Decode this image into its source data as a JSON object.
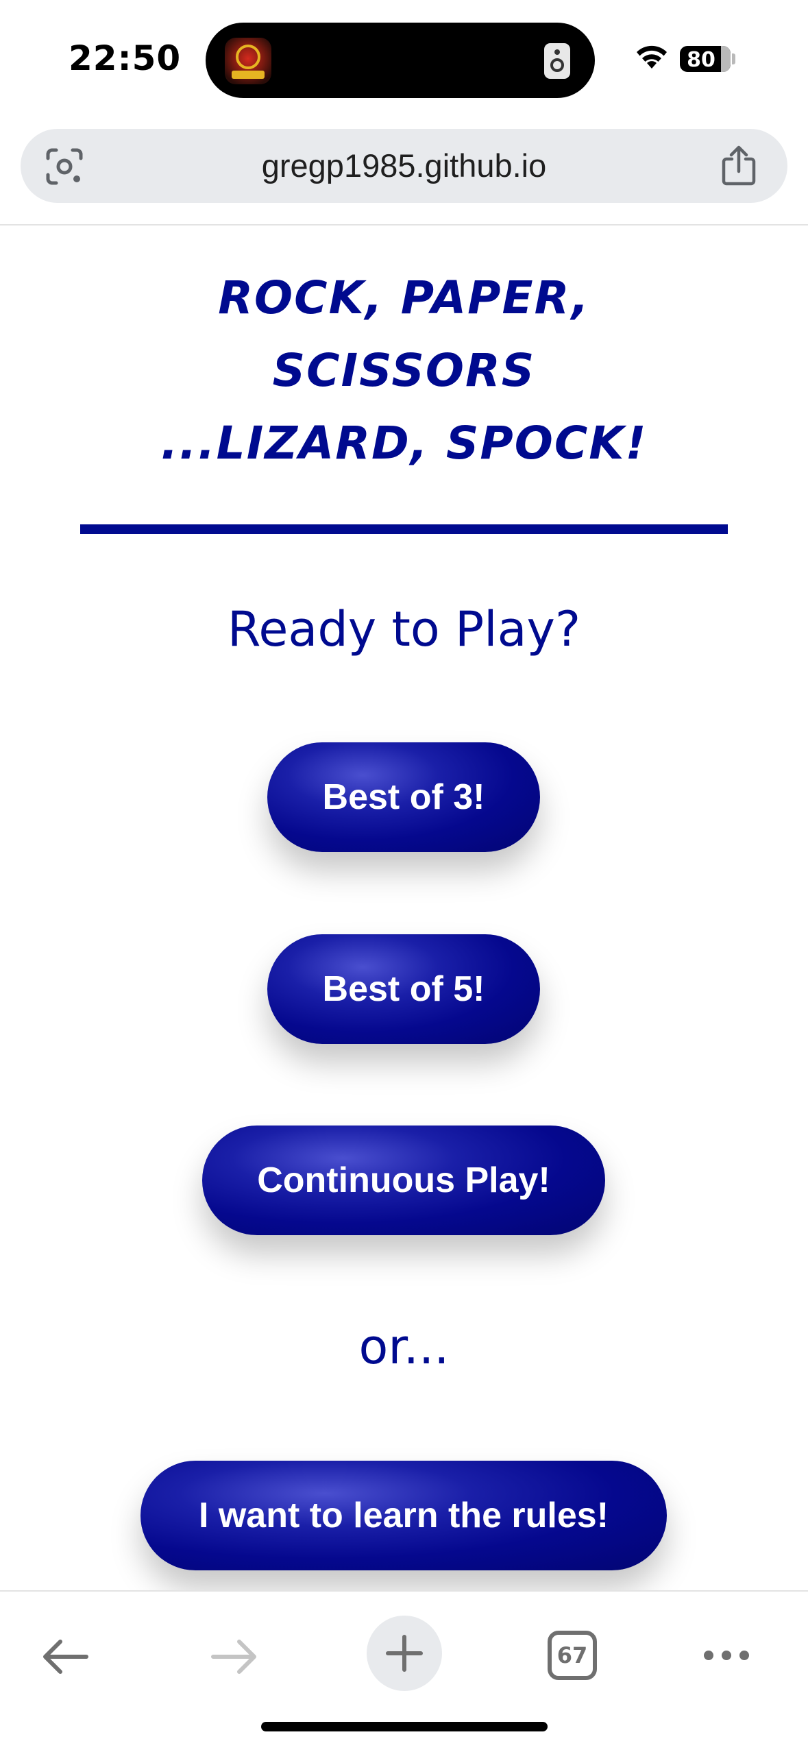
{
  "status_bar": {
    "time": "22:50",
    "battery_percent": "80",
    "icons": [
      "app-thumbnail-icon",
      "speaker-icon",
      "wifi-icon",
      "battery-icon"
    ]
  },
  "browser": {
    "url": "gregp1985.github.io",
    "icons": [
      "lens-icon",
      "share-icon"
    ]
  },
  "page": {
    "title_lines": [
      "Rock, Paper,",
      "Scissors",
      "...Lizard, Spock!"
    ],
    "ready_prompt": "Ready to Play?",
    "buttons": {
      "best_of_3": "Best of 3!",
      "best_of_5": "Best of 5!",
      "continuous": "Continuous Play!",
      "rules": "I want to learn the rules!"
    },
    "or_text": "or...",
    "accent_color": "#000a8f"
  },
  "toolbar": {
    "tab_count": "67",
    "icons": [
      "back-arrow-icon",
      "forward-arrow-icon",
      "plus-icon",
      "tabs-icon",
      "more-icon"
    ]
  }
}
